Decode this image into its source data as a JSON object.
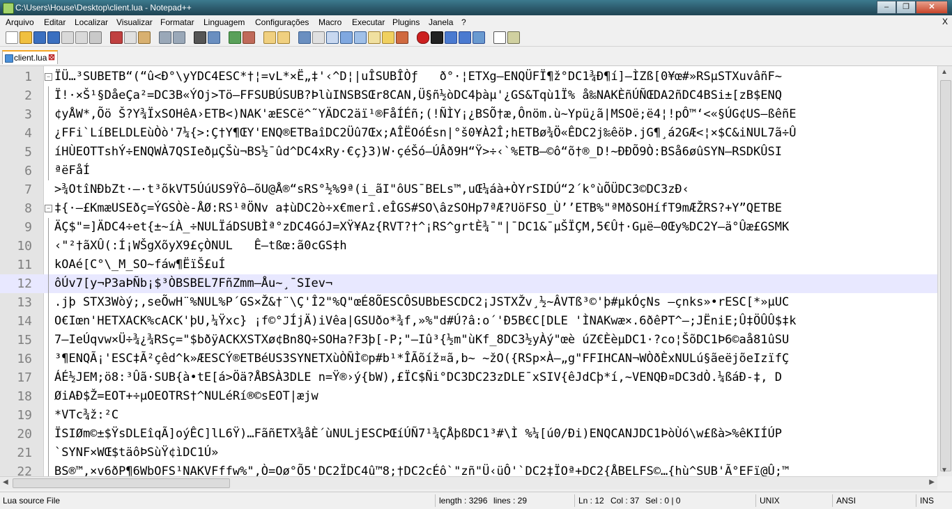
{
  "window": {
    "title": "C:\\Users\\House\\Desktop\\client.lua - Notepad++",
    "minimize": "–",
    "maximize": "❐",
    "close": "✕"
  },
  "menu": {
    "items": [
      "Arquivo",
      "Editar",
      "Localizar",
      "Visualizar",
      "Formatar",
      "Linguagem",
      "Configurações",
      "Macro",
      "Executar",
      "Plugins",
      "Janela",
      "?"
    ],
    "close": "X"
  },
  "tab": {
    "label": "client.lua",
    "close": "⊠"
  },
  "editor": {
    "current_line": 12,
    "lines": [
      {
        "n": "1",
        "text": "ÏÜ…³SUBETB“(“û<Ð°\\yYDC4ESC*†¦=vL*×Ë„‡'‹^D¦|uÎSUBÎÒƒ   ð°·¦ETXg–ENQÜFÏ¶ž°DC1¾Ð¶í]–ÌZß[0¥œ#»RSµSTXuvâñF~"
      },
      {
        "n": "2",
        "text": "Ï!·×Š¹§DåeÇa²=DC3B«ÝOj>Tö–FFSUBÚSUB?ÞlùINSBSŒr8CAN,Ü§ñ½òDC4þàµ'¿GS&Tqù1Ï% å‰NAKÈñÚÑŒDA2ñDC4BSi±[zB$ENQ"
      },
      {
        "n": "3",
        "text": "¢yÅW*,Õö Š?Y¾ÏxSOHêA›ETB<)NAK'æESCë^˜YÄDC2äï¹®FåÍÉñ;(!ÑÌY¡¿BSÕ†æ,Ônöm.ù~Ypü¿ã|MSOë;ë4¦!pÔ™‘<«§ÚG¢US–ßêñE"
      },
      {
        "n": "4",
        "text": "¿FFi`LíBELDLEùÒò'7¼{>:Ç†Y¶ŒY'ENQ®ETBaîDC2Üû7Œx;AÎËOóÉsn|°š0¥À2Î;hETBø¾Ö«ÊDC2j‰êöÞ.jG¶¸á2GÆ<¦×$C&iNUL7ã÷Û"
      },
      {
        "n": "5",
        "text": "íHÙEOTTshÝ÷ENQWÀ7QSIeðµÇŠù¬BS½¯ûd^DC4xRy·€ç}3)W·çéŠó–ÚÂð9H“Ÿ>÷‹`%ETB–©ô“õ†®_D!~ÐÐÕ9Ò:BSå6øûSYN–RSDKÛSI"
      },
      {
        "n": "6",
        "text": "ªëFåÍ"
      },
      {
        "n": "7",
        "text": ">¾OtîNÐbZt·–·t³õkVT5ÚúUS9Ÿô–õU@Å®“sRS°½%9ª(i_ãI\"ôUS¯BELs™,uŒ¼áà+ÒYrSIDÚ“2´k°ùÕÜDC3©DC3zÐ‹"
      },
      {
        "n": "8",
        "text": "‡{·–£KmæUSEðç=ÝGSÒè-ÅØ:RS¹ªÖNv a‡ùDC2ò÷x€merî.eÎGS#SO\\âzSOHp7ªÆ?UöFSO_Ù’’ETB%\"ªMðSOHífT9mÆŽRS?+Y”QETBE"
      },
      {
        "n": "9",
        "text": "ÄÇ$\"=]ÄDC4÷et{±~íÀ_÷NULÏáDSUBÌª°zDC4GóJ=XŸ¥Az{RVT?†^¡RS^grtÈ¾¯\"|¯DC1&¯µŠÏÇM,5€Û†·Gµë—0Œy%DC2Y–ä°Ûæ£GSMK"
      },
      {
        "n": "10",
        "text": "‹\"²†ãXÛ(:Í¡WŠgXõyX9£çÒNUL   Ê–tßœ:ã0cGS‡h"
      },
      {
        "n": "11",
        "text": "kOAé[C°\\_M_SO~fáw¶ËïŠ£uÍ"
      },
      {
        "n": "12",
        "text": "ôÚv7[y¬P3aÞÑb¡$³ÒBSBEL7FñZmm–Åu~¸¯SIev¬"
      },
      {
        "n": "13",
        "text": ".jþ STX3Wòý;,seÕwH¨%NUL%P´GS×Ž&†¨\\Ç'Î2\"%Q\"œÉ8ÕESCÔSUBbESCDC2¡JSTXŽv¸½~ÂVTß³©'þ#µkÓçNs —çnks»•rESC[*»µUC"
      },
      {
        "n": "14",
        "text": "O€Iœn'HETXACK%cACK'þU,¼Ÿxc} ¡f©°JÍjÄ)iVêa|GSUðo*¾f,»%\"d#Ú?â:o´'Ð5B€C[DLE 'ÌNAKwæ×.6ðêPT^–;JËniE;Û‡ÖÛÛ$‡k"
      },
      {
        "n": "15",
        "text": "7—IeÚqvw×Ü÷¾¿¾RSç=\"$bðÿACKXSTXø¢Bn8Q÷SOHa?F3þ[-P;\"–Iû³{½m\"ùKf_8DC3½yÀý\"œè úZ€ÈèµDC1·?co¦ŠõDC1Þ6©aå81ûSU"
      },
      {
        "n": "16",
        "text": "³¶ENQÃ¡'ESC‡Ã²çêd^k»ÆESCÝ®ETBéUS3SYNETXùÒÑÌ©p#b¹*ÎÃõíž¤ã,b~ ~žO({RSp×À–„g\"FFIHCAN¬WÒðÈxNULú§ãeëjõeIzïfÇ"
      },
      {
        "n": "17",
        "text": "ÁÉ½JEM;ö8:³Ûã·SUB{à•tE[á>Öä?ÅBSÀ3DLE n=Ÿ®›ý{bW),£ÏC$Ñi°DC3DC23zDLE¯xSIV{êJdCþ*í,~VENQÐ¤DC3dÒ.¼ßáÐ-‡, D"
      },
      {
        "n": "18",
        "text": "ØiAÐ$Ž=EOT+÷µOEOTRS†^NULéRí®©sEOT|æjw"
      },
      {
        "n": "19",
        "text": "*VTc¾ž:²C"
      },
      {
        "n": "20",
        "text": "ÏSIØm©±$ŸsDLEîqÃ]oýÊC]lL6Ÿ)…FãñETX¾åÈ´ùNULjESCÞŒíÚÑ7¹¾ÇÅþßDC1³#\\Ì %¼[ú0/Ði)ENQCANJDC1ÞòÙó\\w£ßà>%êKIÍÚP"
      },
      {
        "n": "21",
        "text": "`SYNF×WŒ$täôÞSùŸ¢ìDC1Ú»"
      },
      {
        "n": "22",
        "text": "BS®™,×v6ðP¶6WbOFS¹NAKVFffw%\",Ò=Oø°Õ5'DC2ÏDC4û™8;†DC2cÉô`\"zñ\"Ü‹üÔ'`DC2‡ÏOª+DC2{ÅBELFS©…{hù^SUB'Ã°EFï@Û;™"
      }
    ]
  },
  "statusbar": {
    "file_type": "Lua source File",
    "length": "length : 3296",
    "lines": "lines : 29",
    "ln": "Ln : 12",
    "col": "Col : 37",
    "sel": "Sel : 0 | 0",
    "eol": "UNIX",
    "encoding": "ANSI",
    "mode": "INS"
  },
  "colors": {
    "tab_accent": "#f5a623",
    "current_line": "#e8e8ff",
    "gutter": "#e4e4e4",
    "titlebar": "#2c5a6c"
  }
}
